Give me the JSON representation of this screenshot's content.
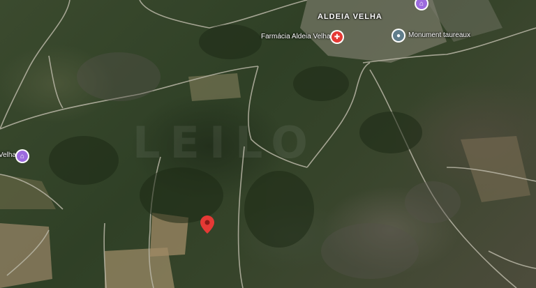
{
  "map": {
    "town_label": "ALDEIA VELHA",
    "watermark": "LEILO",
    "pois": {
      "pharmacy": "Farmácia Aldeia Velha",
      "monument": "Monument taureaux",
      "village_left": "Velha"
    },
    "colors": {
      "pin": "#e53935",
      "pharmacy": "#e53935",
      "monument": "#607d8b",
      "culture": "#9c6ade"
    },
    "icons": [
      "pharmacy-icon",
      "monument-icon",
      "culture-icon",
      "location-pin-icon"
    ]
  }
}
